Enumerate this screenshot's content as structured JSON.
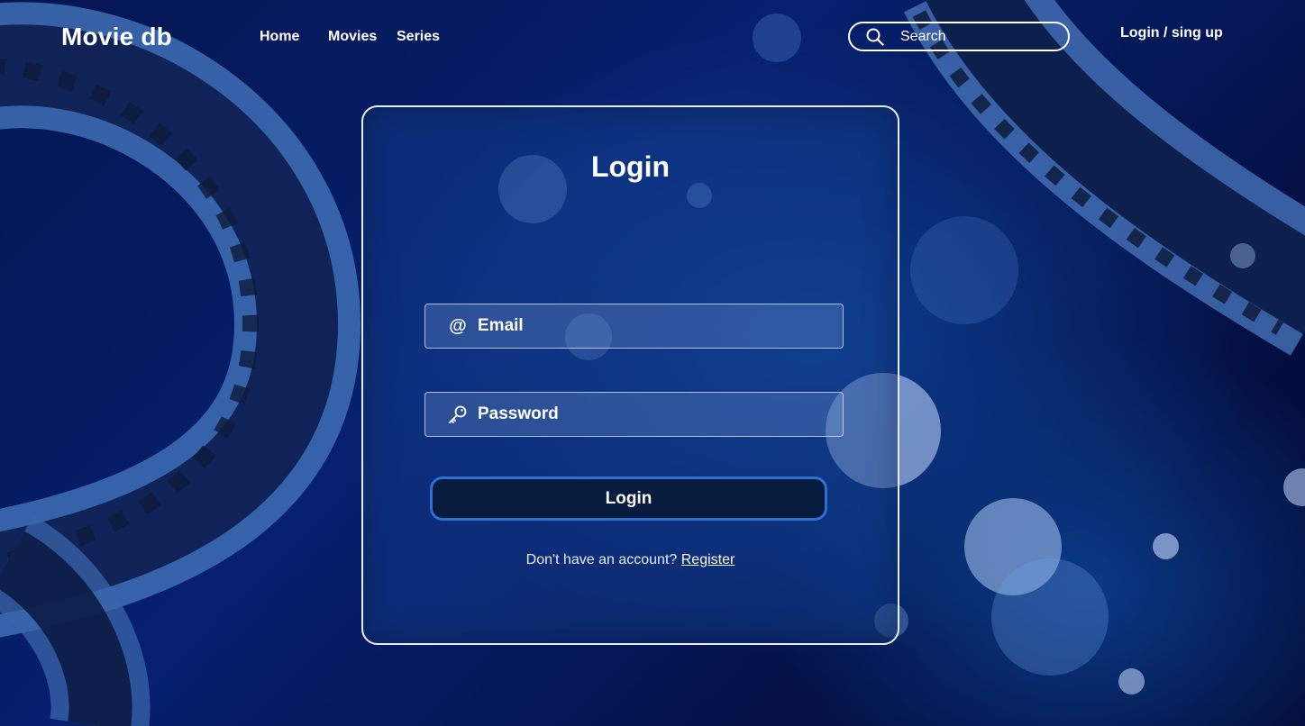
{
  "header": {
    "brand": "Movie db",
    "nav": [
      {
        "label": "Home"
      },
      {
        "label": "Movies"
      },
      {
        "label": "Series"
      }
    ],
    "search": {
      "placeholder": "Search",
      "value": ""
    },
    "auth_label": "Login / sing up"
  },
  "login": {
    "title": "Login",
    "email": {
      "placeholder": "Email",
      "value": "",
      "icon": "at-icon"
    },
    "password": {
      "placeholder": "Password",
      "value": "",
      "icon": "key-icon"
    },
    "submit_label": "Login",
    "register_prompt": "Don't have an account?",
    "register_link": "Register"
  },
  "colors": {
    "background": "#06206e",
    "button_bg": "#061b3e",
    "button_border": "#2f6fd1"
  }
}
